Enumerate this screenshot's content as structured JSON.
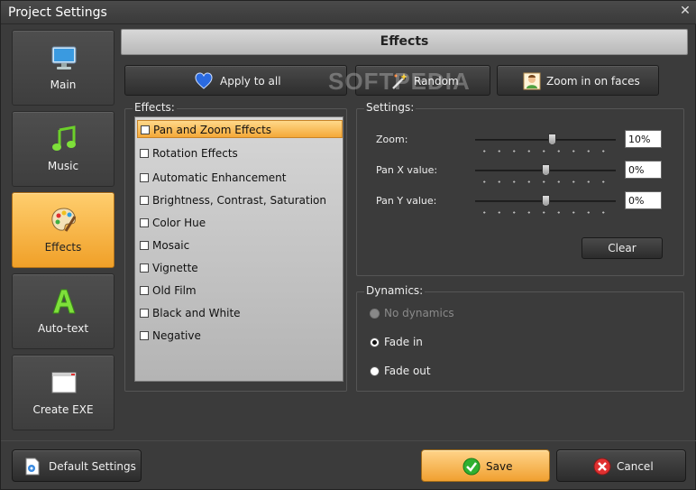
{
  "window": {
    "title": "Project Settings",
    "close_glyph": "✕"
  },
  "sidebar": {
    "items": [
      {
        "label": "Main",
        "icon": "monitor-icon",
        "active": false
      },
      {
        "label": "Music",
        "icon": "music-notes-icon",
        "active": false
      },
      {
        "label": "Effects",
        "icon": "palette-icon",
        "active": true
      },
      {
        "label": "Auto-text",
        "icon": "letter-a-icon",
        "active": false
      },
      {
        "label": "Create EXE",
        "icon": "window-icon",
        "active": false
      }
    ]
  },
  "header": {
    "title": "Effects"
  },
  "toolbar": {
    "apply_all": "Apply to all",
    "random": "Random",
    "zoom_faces": "Zoom in on faces"
  },
  "watermark": "SOFTPEDIA",
  "effects": {
    "title": "Effects:",
    "items": [
      {
        "label": "Pan and Zoom Effects",
        "checked": false,
        "selected": true
      },
      {
        "label": "Rotation Effects",
        "checked": false,
        "selected": false
      },
      {
        "label": "Automatic Enhancement",
        "checked": false,
        "selected": false
      },
      {
        "label": "Brightness, Contrast, Saturation",
        "checked": false,
        "selected": false
      },
      {
        "label": "Color Hue",
        "checked": false,
        "selected": false
      },
      {
        "label": "Mosaic",
        "checked": false,
        "selected": false
      },
      {
        "label": "Vignette",
        "checked": false,
        "selected": false
      },
      {
        "label": "Old Film",
        "checked": false,
        "selected": false
      },
      {
        "label": "Black and White",
        "checked": false,
        "selected": false
      },
      {
        "label": "Negative",
        "checked": false,
        "selected": false
      }
    ]
  },
  "settings": {
    "title": "Settings:",
    "zoom": {
      "label": "Zoom:",
      "value": "10%",
      "level": 0.55
    },
    "pan_x": {
      "label": "Pan X value:",
      "value": "0%",
      "level": 0.5
    },
    "pan_y": {
      "label": "Pan Y value:",
      "value": "0%",
      "level": 0.5
    },
    "clear": "Clear"
  },
  "dynamics": {
    "title": "Dynamics:",
    "options": [
      {
        "label": "No dynamics",
        "checked": false,
        "disabled": true
      },
      {
        "label": "Fade in",
        "checked": true,
        "disabled": false
      },
      {
        "label": "Fade out",
        "checked": false,
        "disabled": false
      }
    ]
  },
  "footer": {
    "default_settings": "Default Settings",
    "save": "Save",
    "cancel": "Cancel"
  },
  "colors": {
    "accent": "#f0a030",
    "background": "#3b3b3b"
  }
}
